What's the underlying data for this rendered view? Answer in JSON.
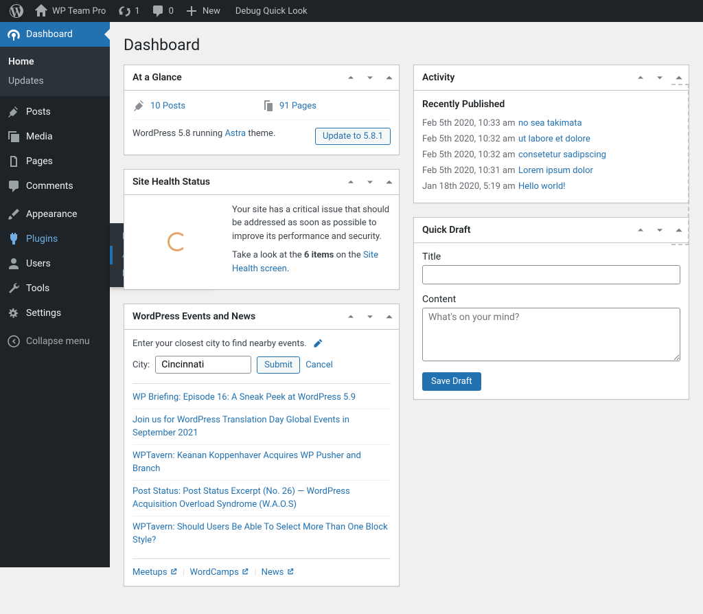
{
  "adminbar": {
    "site_name": "WP Team Pro",
    "updates_count": "1",
    "comments_count": "0",
    "new_label": "New",
    "debug_label": "Debug Quick Look"
  },
  "sidebar": {
    "dashboard": "Dashboard",
    "home": "Home",
    "updates": "Updates",
    "posts": "Posts",
    "media": "Media",
    "pages": "Pages",
    "comments": "Comments",
    "appearance": "Appearance",
    "plugins": "Plugins",
    "users": "Users",
    "tools": "Tools",
    "settings": "Settings",
    "collapse": "Collapse menu"
  },
  "plugins_flyout": {
    "installed": "Installed Plugins",
    "add_new": "Add New",
    "editor": "Plugin Editor"
  },
  "page_title": "Dashboard",
  "glance": {
    "title": "At a Glance",
    "posts": "10 Posts",
    "pages": "91 Pages",
    "version_prefix": "WordPress 5.8 running ",
    "theme": "Astra",
    "version_suffix": " theme.",
    "update_btn": "Update to 5.8.1"
  },
  "health": {
    "title": "Site Health Status",
    "text_prefix": "Your site has a critical issue that should be addressed as soon as possible to improve its performance and security.",
    "text2_prefix": "Take a look at the ",
    "text2_bold": "6 items",
    "text2_mid": " on the ",
    "text2_link": "Site Health screen",
    "text2_suffix": "."
  },
  "events": {
    "title": "WordPress Events and News",
    "prompt": "Enter your closest city to find nearby events.",
    "city_label": "City:",
    "city_value": "Cincinnati",
    "submit": "Submit",
    "cancel": "Cancel",
    "news": [
      "WP Briefing: Episode 16: A Sneak Peek at WordPress 5.9",
      "Join us for WordPress Translation Day Global Events in September 2021",
      "WPTavern: Keanan Koppenhaver Acquires WP Pusher and Branch",
      "Post Status: Post Status Excerpt (No. 26) — WordPress Acquisition Overload Syndrome (W.A.O.S)",
      "WPTavern: Should Users Be Able To Select More Than One Block Style?"
    ],
    "links": {
      "meetups": "Meetups",
      "wordcamps": "WordCamps",
      "news_link": "News"
    }
  },
  "activity": {
    "title": "Activity",
    "section": "Recently Published",
    "items": [
      {
        "date": "Feb 5th 2020, 10:33 am",
        "title": "no sea takimata"
      },
      {
        "date": "Feb 5th 2020, 10:32 am",
        "title": "ut labore et dolore"
      },
      {
        "date": "Feb 5th 2020, 10:32 am",
        "title": "consetetur sadipscing"
      },
      {
        "date": "Feb 5th 2020, 10:31 am",
        "title": "Lorem ipsum dolor"
      },
      {
        "date": "Jan 18th 2020, 5:19 am",
        "title": "Hello world!"
      }
    ]
  },
  "draft": {
    "title": "Quick Draft",
    "title_label": "Title",
    "content_label": "Content",
    "placeholder": "What's on your mind?",
    "save": "Save Draft"
  }
}
